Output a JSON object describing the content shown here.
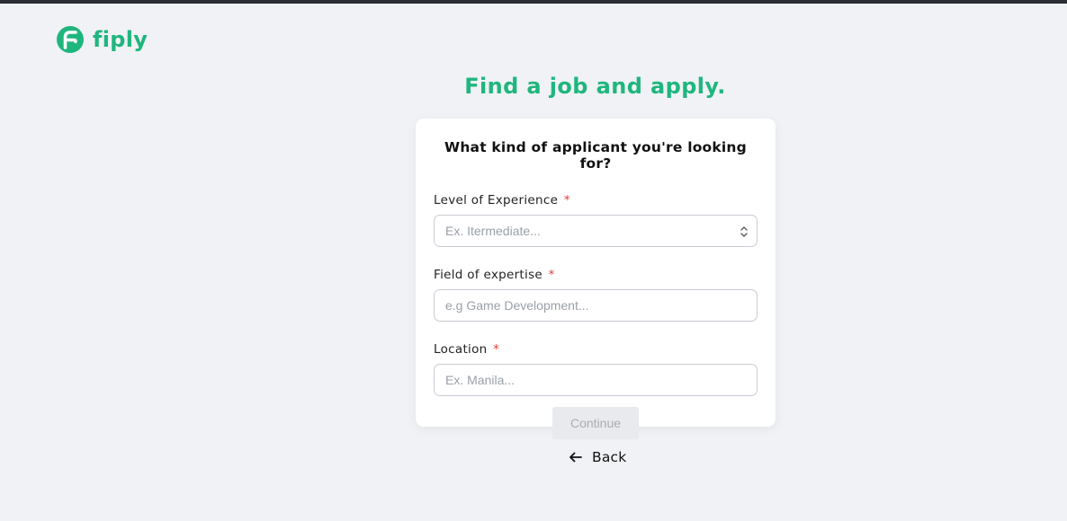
{
  "brand": {
    "name": "fiply",
    "logo_icon": "fiply-logo-icon",
    "accent_color": "#1fb67e"
  },
  "headline": "Find a job and apply.",
  "form": {
    "title": "What kind of applicant you're looking for?",
    "required_marker": "*",
    "fields": [
      {
        "label": "Level of Experience",
        "type": "select",
        "placeholder": "Ex. Itermediate...",
        "value": ""
      },
      {
        "label": "Field of expertise",
        "type": "text",
        "placeholder": "e.g Game Development...",
        "value": ""
      },
      {
        "label": "Location",
        "type": "text",
        "placeholder": "Ex. Manila...",
        "value": ""
      }
    ],
    "submit_label": "Continue",
    "submit_disabled": true
  },
  "back": {
    "label": "Back",
    "icon": "arrow-left-icon"
  }
}
